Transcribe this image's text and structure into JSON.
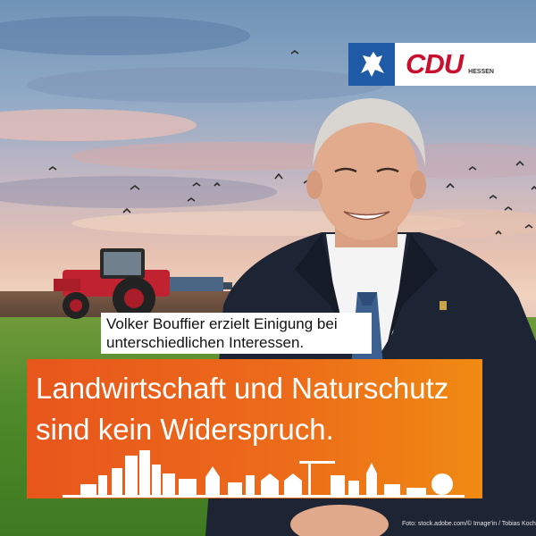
{
  "logo": {
    "brand": "CDU",
    "region": "HESSEN",
    "crest_icon": "hessen-lion-icon",
    "brand_color": "#c8102e",
    "crest_color": "#1f5aa6"
  },
  "caption": {
    "line1": "Volker Bouffier erzielt Einigung bei",
    "line2": "unterschiedlichen Interessen."
  },
  "headline": {
    "line1": "Landwirtschaft und Naturschutz",
    "line2": "sind kein Widerspruch.",
    "background_color": "#ec6a1a"
  },
  "credit": "Foto: stock.adobe.com/© Image'in / Tobias Koch",
  "decor": {
    "skyline_icon": "city-skyline-icon",
    "tractor_icon": "tractor-icon"
  }
}
